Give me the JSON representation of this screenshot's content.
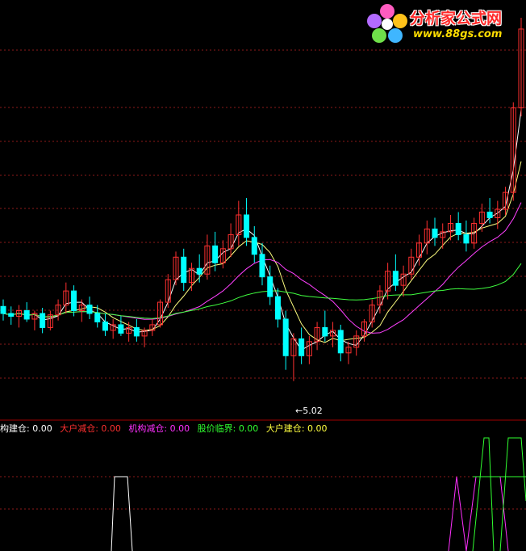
{
  "logo": {
    "cn": "分析家公式网",
    "url": "www.88gs.com"
  },
  "legend": [
    {
      "name": "构建仓",
      "value": "0.00",
      "color": "#ffffff"
    },
    {
      "name": "大户减仓",
      "value": "0.00",
      "color": "#ff3030"
    },
    {
      "name": "机构减仓",
      "value": "0.00",
      "color": "#ff30ff"
    },
    {
      "name": "股价临界",
      "value": "0.00",
      "color": "#30ff30"
    },
    {
      "name": "大户建仓",
      "value": "0.00",
      "color": "#ffff40"
    }
  ],
  "low_label": "5.02",
  "colors": {
    "background": "#000000",
    "grid": "#8b1a1a",
    "divider": "#a00000",
    "up": "#ff3030",
    "down": "#00ffff",
    "ma_short": "#ffffff",
    "ma_mid": "#ffff80",
    "ma_long": "#ff40ff",
    "ma_very_long": "#40ff40"
  },
  "chart_data": [
    {
      "type": "candlestick",
      "price_low_label": 5.02,
      "ylim": [
        4.8,
        7.6
      ],
      "series": [
        {
          "name": "candles",
          "ohlc": [
            [
              5.55,
              5.6,
              5.45,
              5.5
            ],
            [
              5.5,
              5.55,
              5.42,
              5.48
            ],
            [
              5.48,
              5.56,
              5.4,
              5.52
            ],
            [
              5.52,
              5.58,
              5.44,
              5.46
            ],
            [
              5.46,
              5.52,
              5.38,
              5.5
            ],
            [
              5.5,
              5.54,
              5.36,
              5.4
            ],
            [
              5.4,
              5.52,
              5.38,
              5.49
            ],
            [
              5.49,
              5.6,
              5.45,
              5.56
            ],
            [
              5.56,
              5.72,
              5.5,
              5.66
            ],
            [
              5.66,
              5.7,
              5.48,
              5.52
            ],
            [
              5.52,
              5.6,
              5.44,
              5.56
            ],
            [
              5.56,
              5.62,
              5.46,
              5.5
            ],
            [
              5.5,
              5.56,
              5.4,
              5.44
            ],
            [
              5.44,
              5.5,
              5.34,
              5.38
            ],
            [
              5.38,
              5.46,
              5.32,
              5.42
            ],
            [
              5.42,
              5.48,
              5.34,
              5.36
            ],
            [
              5.36,
              5.44,
              5.3,
              5.4
            ],
            [
              5.4,
              5.46,
              5.3,
              5.34
            ],
            [
              5.34,
              5.4,
              5.26,
              5.38
            ],
            [
              5.38,
              5.46,
              5.34,
              5.42
            ],
            [
              5.42,
              5.6,
              5.4,
              5.58
            ],
            [
              5.58,
              5.78,
              5.54,
              5.74
            ],
            [
              5.74,
              5.94,
              5.7,
              5.9
            ],
            [
              5.9,
              5.96,
              5.66,
              5.72
            ],
            [
              5.72,
              5.86,
              5.66,
              5.82
            ],
            [
              5.82,
              5.92,
              5.72,
              5.78
            ],
            [
              5.78,
              6.06,
              5.74,
              5.98
            ],
            [
              5.98,
              6.08,
              5.8,
              5.86
            ],
            [
              5.86,
              6.02,
              5.82,
              5.96
            ],
            [
              5.96,
              6.14,
              5.9,
              6.06
            ],
            [
              6.06,
              6.3,
              5.98,
              6.2
            ],
            [
              6.2,
              6.32,
              5.98,
              6.04
            ],
            [
              6.04,
              6.12,
              5.86,
              5.92
            ],
            [
              5.92,
              6.0,
              5.7,
              5.76
            ],
            [
              5.76,
              5.84,
              5.56,
              5.62
            ],
            [
              5.62,
              5.68,
              5.4,
              5.46
            ],
            [
              5.46,
              5.52,
              5.1,
              5.2
            ],
            [
              5.2,
              5.36,
              5.02,
              5.32
            ],
            [
              5.32,
              5.4,
              5.14,
              5.2
            ],
            [
              5.2,
              5.34,
              5.14,
              5.3
            ],
            [
              5.3,
              5.44,
              5.24,
              5.4
            ],
            [
              5.4,
              5.52,
              5.3,
              5.34
            ],
            [
              5.34,
              5.44,
              5.26,
              5.38
            ],
            [
              5.38,
              5.42,
              5.16,
              5.22
            ],
            [
              5.22,
              5.3,
              5.14,
              5.26
            ],
            [
              5.26,
              5.38,
              5.2,
              5.34
            ],
            [
              5.34,
              5.46,
              5.3,
              5.44
            ],
            [
              5.44,
              5.6,
              5.4,
              5.56
            ],
            [
              5.56,
              5.7,
              5.5,
              5.66
            ],
            [
              5.66,
              5.86,
              5.6,
              5.8
            ],
            [
              5.8,
              5.92,
              5.66,
              5.7
            ],
            [
              5.7,
              5.84,
              5.62,
              5.78
            ],
            [
              5.78,
              5.96,
              5.74,
              5.9
            ],
            [
              5.9,
              6.06,
              5.84,
              6.0
            ],
            [
              6.0,
              6.16,
              5.92,
              6.1
            ],
            [
              6.1,
              6.18,
              5.98,
              6.04
            ],
            [
              6.04,
              6.14,
              5.96,
              6.08
            ],
            [
              6.08,
              6.2,
              6.02,
              6.14
            ],
            [
              6.14,
              6.22,
              6.02,
              6.06
            ],
            [
              6.06,
              6.16,
              5.94,
              6.0
            ],
            [
              6.0,
              6.18,
              5.96,
              6.14
            ],
            [
              6.14,
              6.28,
              6.08,
              6.22
            ],
            [
              6.22,
              6.32,
              6.14,
              6.18
            ],
            [
              6.18,
              6.3,
              6.1,
              6.24
            ],
            [
              6.24,
              6.4,
              6.2,
              6.36
            ],
            [
              6.36,
              7.0,
              6.3,
              6.96
            ],
            [
              6.96,
              7.6,
              6.9,
              7.52
            ]
          ]
        }
      ]
    },
    {
      "type": "line",
      "ylim": [
        0,
        100
      ],
      "series": [
        {
          "name": "构建仓",
          "color": "#ffffff",
          "values": [
            0,
            0,
            0,
            0,
            0,
            0,
            0,
            0,
            0,
            0,
            0,
            0,
            0,
            0,
            0,
            0,
            0,
            0,
            0,
            0,
            0,
            0,
            0,
            0,
            0,
            0,
            0,
            0,
            0,
            0,
            0,
            0,
            0,
            0,
            0,
            0,
            0,
            0,
            0,
            0,
            0,
            0,
            0,
            0,
            0,
            0,
            0,
            0,
            0,
            0,
            0,
            0,
            0,
            0,
            0,
            0,
            0,
            0,
            0,
            0,
            0,
            0,
            0,
            0,
            0,
            0,
            0
          ]
        },
        {
          "name": "机构减仓",
          "color": "#ff30ff",
          "values": []
        },
        {
          "name": "股价临界",
          "color": "#30ff30",
          "values": []
        }
      ]
    }
  ]
}
